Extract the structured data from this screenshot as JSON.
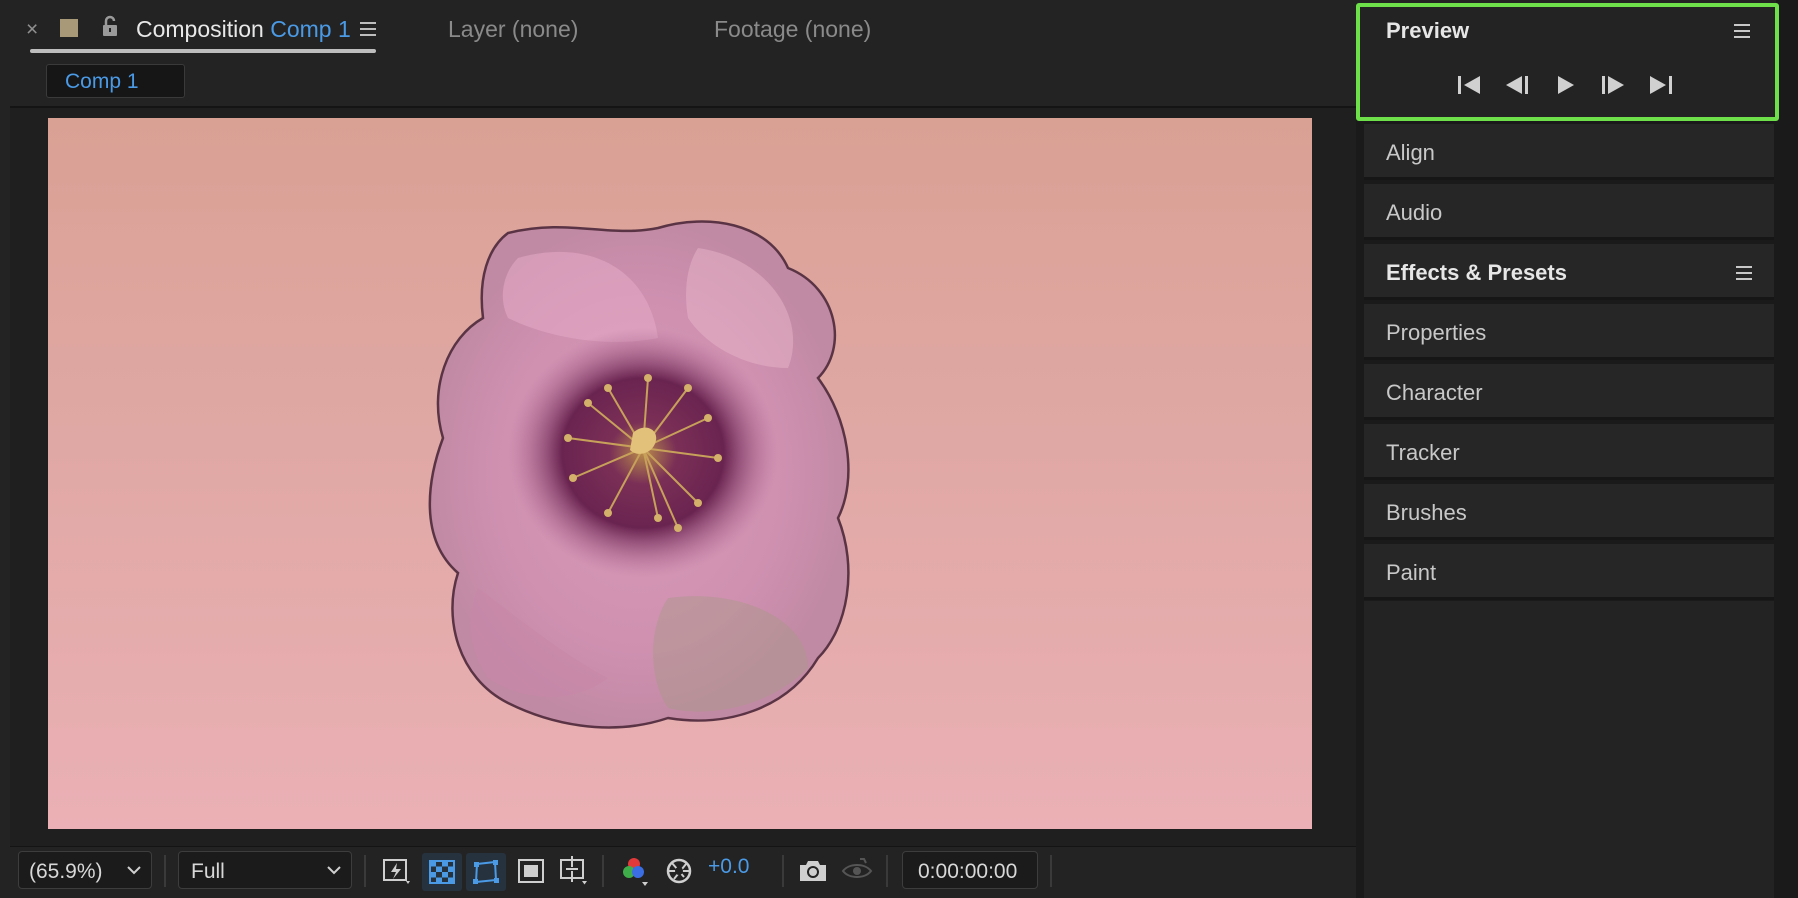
{
  "composition_panel": {
    "close_symbol": "×",
    "tab_title": "Composition",
    "tab_comp_name": "Comp 1",
    "layer_tab": "Layer (none)",
    "footage_tab": "Footage (none)",
    "breadcrumb": "Comp 1",
    "label_color": "#a89a78",
    "accent_color": "#4a9ae6",
    "icons": [
      "close-icon",
      "label-color-swatch",
      "lock-icon",
      "panel-menu-icon"
    ]
  },
  "viewer_toolbar": {
    "magnification": "(65.9%)",
    "resolution": "Full",
    "exposure": "+0.0",
    "timecode": "0:00:00:00",
    "icons": [
      "fast-previews-icon",
      "transparency-grid-icon",
      "mask-visibility-icon",
      "region-of-interest-icon",
      "grid-guides-icon",
      "channel-icon",
      "exposure-reset-icon",
      "snapshot-icon",
      "show-snapshot-icon"
    ]
  },
  "right_panels": {
    "preview": {
      "title": "Preview",
      "controls": [
        "first-frame",
        "previous-frame",
        "play",
        "next-frame",
        "last-frame"
      ],
      "highlight_color": "#6ee04a"
    },
    "panels": [
      "Align",
      "Audio",
      "Effects & Presets",
      "Properties",
      "Character",
      "Tracker",
      "Brushes",
      "Paint"
    ]
  }
}
